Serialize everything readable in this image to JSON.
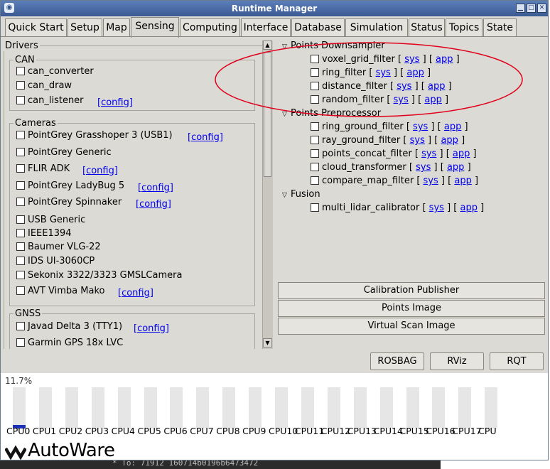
{
  "window": {
    "title": "Runtime Manager"
  },
  "tabs": [
    {
      "label": "Quick Start"
    },
    {
      "label": "Setup"
    },
    {
      "label": "Map"
    },
    {
      "label": "Sensing"
    },
    {
      "label": "Computing"
    },
    {
      "label": "Interface"
    },
    {
      "label": "Database"
    },
    {
      "label": "Simulation"
    },
    {
      "label": "Status"
    },
    {
      "label": "Topics"
    },
    {
      "label": "State"
    }
  ],
  "drivers": {
    "title": "Drivers",
    "can": {
      "title": "CAN",
      "items": [
        {
          "label": "can_converter",
          "config": ""
        },
        {
          "label": "can_draw",
          "config": ""
        },
        {
          "label": "can_listener",
          "config": "[config]"
        }
      ]
    },
    "cameras": {
      "title": "Cameras",
      "items": [
        {
          "label": "PointGrey Grasshoper 3 (USB1)",
          "config": "[config]"
        },
        {
          "label": "PointGrey Generic",
          "config": ""
        },
        {
          "label": "FLIR ADK",
          "config": "[config]"
        },
        {
          "label": "PointGrey LadyBug 5",
          "config": "[config]"
        },
        {
          "label": "PointGrey Spinnaker",
          "config": "[config]"
        },
        {
          "label": "USB Generic",
          "config": ""
        },
        {
          "label": "IEEE1394",
          "config": ""
        },
        {
          "label": "Baumer VLG-22",
          "config": ""
        },
        {
          "label": "IDS UI-3060CP",
          "config": ""
        },
        {
          "label": "Sekonix 3322/3323 GMSLCamera",
          "config": ""
        },
        {
          "label": "AVT Vimba Mako",
          "config": "[config]"
        }
      ]
    },
    "gnss": {
      "title": "GNSS",
      "items": [
        {
          "label": "Javad Delta 3 (TTY1)",
          "config": "[config]"
        },
        {
          "label": "Garmin GPS 18x LVC",
          "config": ""
        }
      ]
    }
  },
  "tree": {
    "links": {
      "open": "[",
      "close": "]",
      "sys": "sys",
      "app": "app"
    },
    "groups": [
      {
        "title": "Points Downsampler",
        "items": [
          "voxel_grid_filter",
          "ring_filter",
          "distance_filter",
          "random_filter"
        ]
      },
      {
        "title": "Points Preprocessor",
        "items": [
          "ring_ground_filter",
          "ray_ground_filter",
          "points_concat_filter",
          "cloud_transformer",
          "compare_map_filter"
        ]
      },
      {
        "title": "Fusion",
        "items": [
          "multi_lidar_calibrator"
        ]
      }
    ]
  },
  "buttons": {
    "calibration_publisher": "Calibration Publisher",
    "points_image": "Points Image",
    "virtual_scan_image": "Virtual Scan Image",
    "rosbag": "ROSBAG",
    "rviz": "RViz",
    "rqt": "RQT"
  },
  "cpu": {
    "percent_label": "11.7%",
    "labels": [
      "CPU0",
      "CPU1",
      "CPU2",
      "CPU3",
      "CPU4",
      "CPU5",
      "CPU6",
      "CPU7",
      "CPU8",
      "CPU9",
      "CPU10",
      "CPU11",
      "CPU12",
      "CPU13",
      "CPU14",
      "CPU15",
      "CPU16",
      "CPU17",
      "CPU"
    ],
    "loads": [
      0.08,
      0,
      0,
      0,
      0,
      0,
      0,
      0,
      0,
      0,
      0,
      0,
      0,
      0,
      0,
      0,
      0,
      0,
      0
    ],
    "bar_color": "#1a31b8"
  },
  "logo": {
    "text": "AutoWare"
  },
  "background_terminal": {
    "text": "* To: 71912 160714b0196b6473472"
  },
  "annotation": {
    "color": "#e0001b"
  }
}
